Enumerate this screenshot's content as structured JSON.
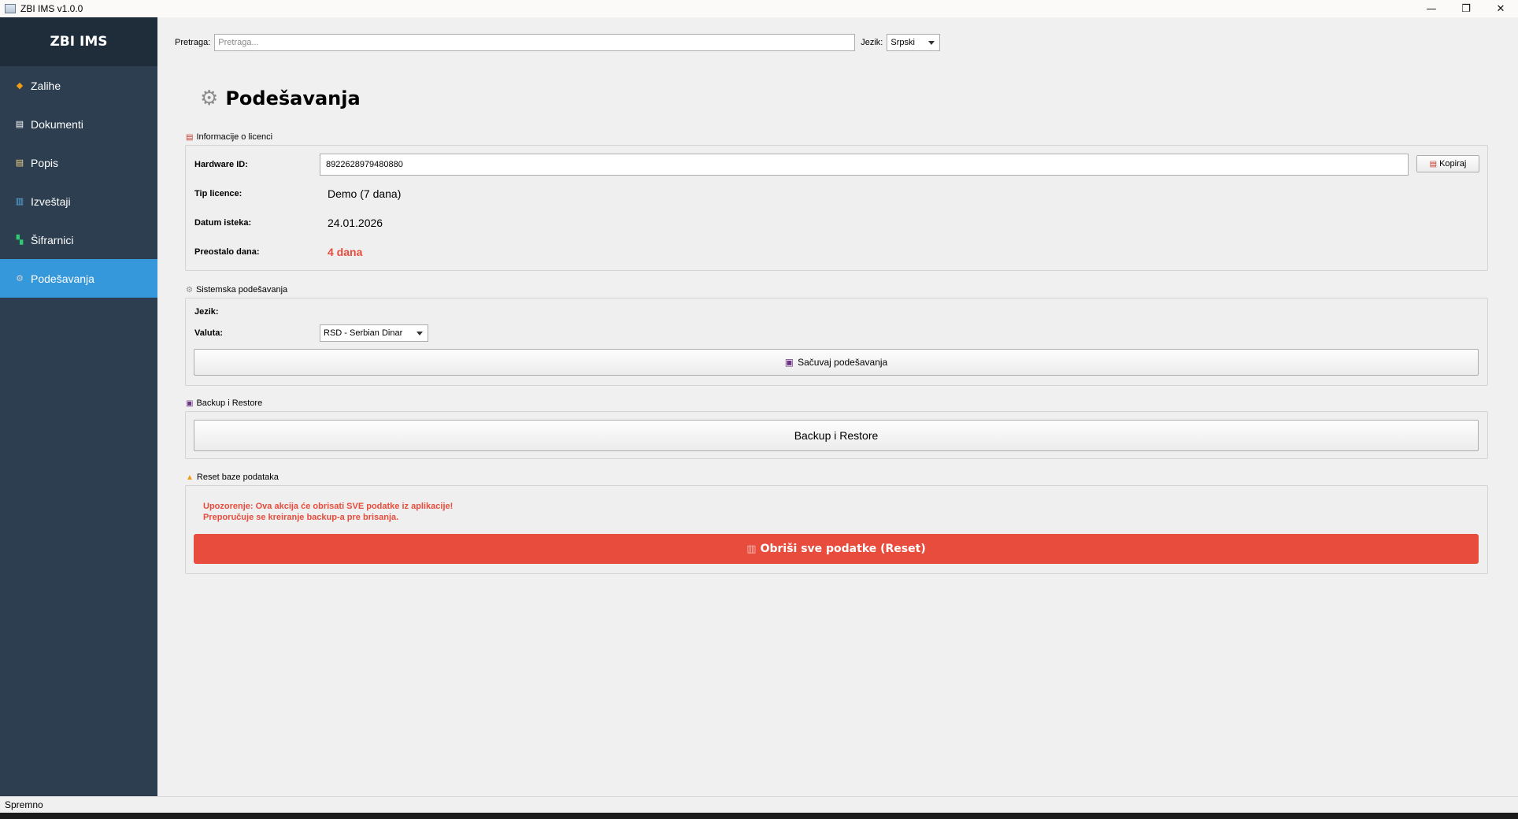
{
  "window": {
    "title": "ZBI IMS v1.0.0",
    "minimize": "—",
    "maximize": "❐",
    "close": "✕"
  },
  "sidebar": {
    "brand": "ZBI IMS",
    "items": [
      {
        "label": "Zalihe",
        "icon": "box-icon",
        "glyph": "◆",
        "color": "#f39c12"
      },
      {
        "label": "Dokumenti",
        "icon": "document-icon",
        "glyph": "▤",
        "color": "#ffffff"
      },
      {
        "label": "Popis",
        "icon": "clipboard-icon",
        "glyph": "▤",
        "color": "#f5d58a"
      },
      {
        "label": "Izveštaji",
        "icon": "chart-icon",
        "glyph": "▥",
        "color": "#5dade2"
      },
      {
        "label": "Šifrarnici",
        "icon": "blocks-icon",
        "glyph": "▚",
        "color": "#2ecc71"
      },
      {
        "label": "Podešavanja",
        "icon": "gear-icon",
        "glyph": "⚙",
        "color": "#d0d0d0"
      }
    ],
    "active_index": 5
  },
  "topbar": {
    "search_label": "Pretraga:",
    "search_placeholder": "Pretraga...",
    "language_label": "Jezik:",
    "language_value": "Srpski"
  },
  "page": {
    "title": "Podešavanja",
    "title_icon": "gear-icon"
  },
  "license": {
    "group_title": "Informacije o licenci",
    "hardware_id_label": "Hardware ID:",
    "hardware_id_value": "8922628979480880",
    "copy_button": "Kopiraj",
    "license_type_label": "Tip licence:",
    "license_type_value": "Demo (7 dana)",
    "expiry_label": "Datum isteka:",
    "expiry_value": "24.01.2026",
    "days_left_label": "Preostalo dana:",
    "days_left_value": "4 dana"
  },
  "system": {
    "group_title": "Sistemska podešavanja",
    "language_label": "Jezik:",
    "currency_label": "Valuta:",
    "currency_value": "RSD - Serbian Dinar",
    "save_button": "Sačuvaj podešavanja"
  },
  "backup": {
    "group_title": "Backup i Restore",
    "button": "Backup i Restore"
  },
  "reset": {
    "group_title": "Reset baze podataka",
    "warning_line1": "Upozorenje: Ova akcija će obrisati SVE podatke iz aplikacije!",
    "warning_line2": "Preporučuje se kreiranje backup-a pre brisanja.",
    "button": "Obriši sve podatke (Reset)"
  },
  "statusbar": {
    "text": "Spremno"
  },
  "colors": {
    "sidebar_bg": "#2c3e50",
    "brand_bg": "#1f2d3b",
    "active": "#3498db",
    "danger": "#e74c3c"
  }
}
